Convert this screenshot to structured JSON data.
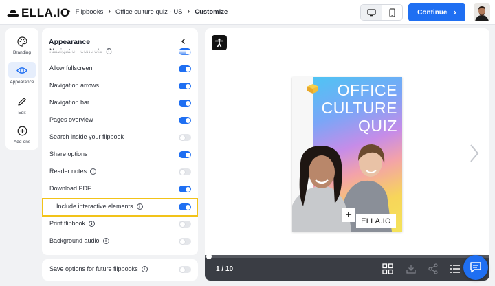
{
  "brand": {
    "logo_text": "ELLA.IO"
  },
  "breadcrumb": {
    "items": [
      "Flipbooks",
      "Office culture quiz - US",
      "Customize"
    ]
  },
  "header": {
    "continue_label": "Continue"
  },
  "rail": {
    "items": [
      {
        "label": "Branding",
        "icon": "palette-icon"
      },
      {
        "label": "Appearance",
        "icon": "eye-icon",
        "active": true
      },
      {
        "label": "Edit",
        "icon": "pencil-icon"
      },
      {
        "label": "Add-ons",
        "icon": "plus-circle-icon"
      }
    ]
  },
  "panel": {
    "title": "Appearance",
    "options": [
      {
        "label": "Navigation controls",
        "info": true,
        "on": true
      },
      {
        "label": "Allow fullscreen",
        "info": false,
        "on": true
      },
      {
        "label": "Navigation arrows",
        "info": false,
        "on": true
      },
      {
        "label": "Navigation bar",
        "info": false,
        "on": true
      },
      {
        "label": "Pages overview",
        "info": false,
        "on": true
      },
      {
        "label": "Search inside your flipbook",
        "info": false,
        "on": false
      },
      {
        "label": "Share options",
        "info": false,
        "on": true
      },
      {
        "label": "Reader notes",
        "info": true,
        "on": false
      },
      {
        "label": "Download PDF",
        "info": false,
        "on": true
      },
      {
        "label": "Include interactive elements",
        "info": true,
        "on": true,
        "highlighted": true
      },
      {
        "label": "Print flipbook",
        "info": true,
        "on": false
      },
      {
        "label": "Background audio",
        "info": true,
        "on": false
      }
    ],
    "info_glyph": "i"
  },
  "save_options": {
    "label": "Save options for future flipbooks",
    "info": true,
    "on": false
  },
  "preview": {
    "cover_title_lines": [
      "OFFICE",
      "CULTURE",
      "QUIZ"
    ],
    "cover_brand": "ELLA.IO",
    "cover_plus": "+",
    "page_indicator": "1 / 10",
    "progress": 0.1
  },
  "colors": {
    "accent": "#1f6ff2",
    "highlight": "#f2c319",
    "toolbar": "#3a3d44"
  }
}
